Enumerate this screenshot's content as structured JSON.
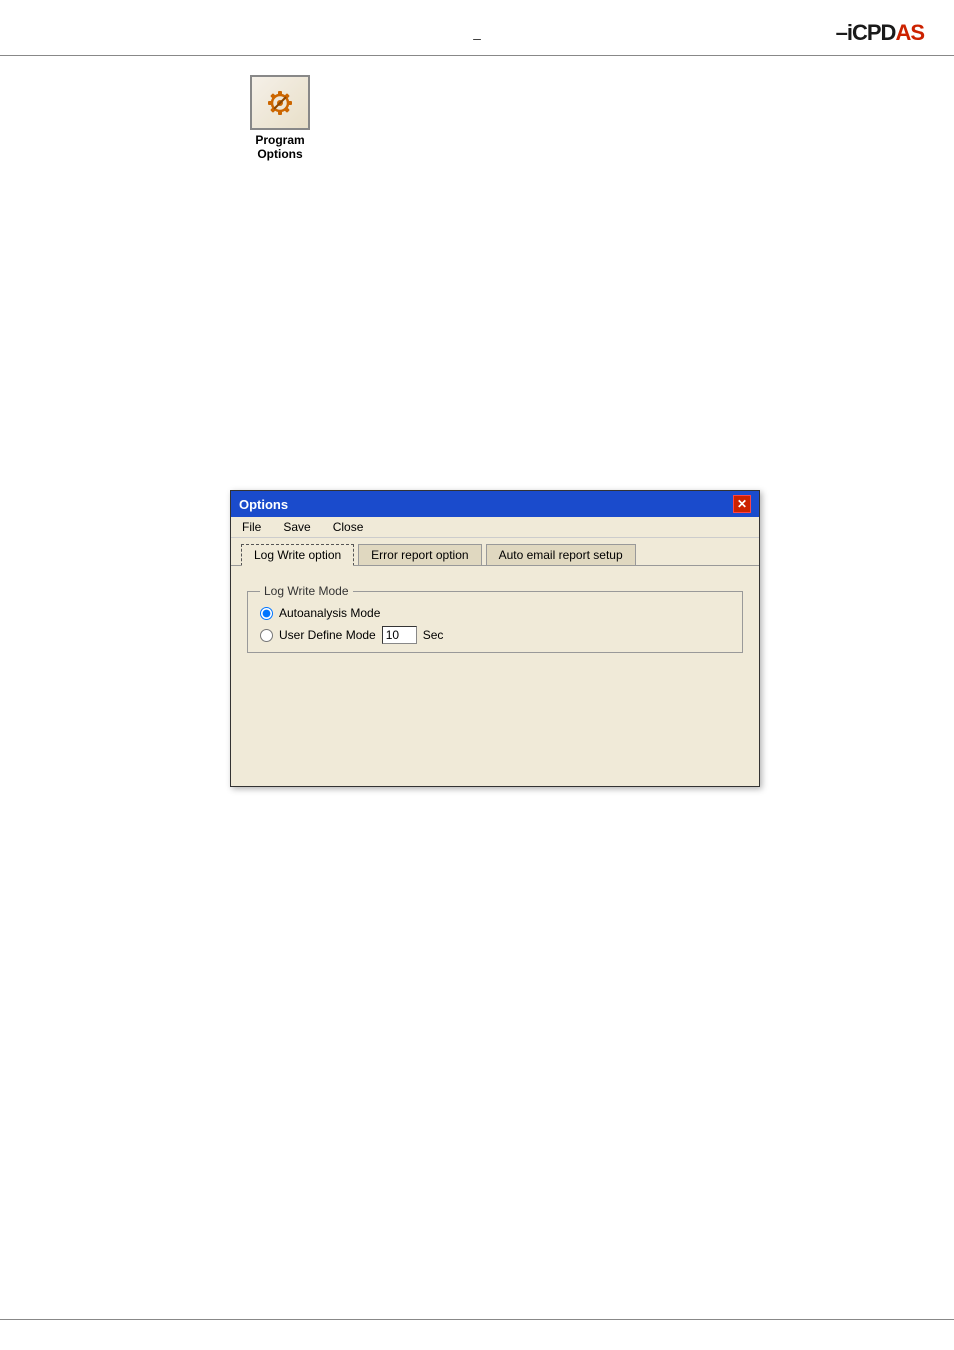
{
  "page": {
    "background": "#ffffff"
  },
  "logo": {
    "text_icpd": "iCPD",
    "text_as": "AS",
    "full": "iCPDAS"
  },
  "minimize": {
    "label": "–"
  },
  "program_options_icon": {
    "label_line1": "Program",
    "label_line2": "Options"
  },
  "body_text": {
    "para1_quote_open": "\"",
    "para1_quote_close": "\"",
    "para2_bullet": "●",
    "para3_quote_open": "\"",
    "para3_quote_close": "\""
  },
  "dialog": {
    "title": "Options",
    "close_btn_label": "✕",
    "menu": {
      "file": "File",
      "save": "Save",
      "close": "Close"
    },
    "tabs": [
      {
        "label": "Log Write option",
        "active": true
      },
      {
        "label": "Error report option",
        "active": false
      },
      {
        "label": "Auto email report setup",
        "active": false
      }
    ],
    "log_write_mode": {
      "group_label": "Log Write Mode",
      "auto_label": "Autoanalysis Mode",
      "user_label": "User Define Mode",
      "interval_value": "10",
      "interval_unit": "Sec",
      "auto_selected": true
    }
  }
}
